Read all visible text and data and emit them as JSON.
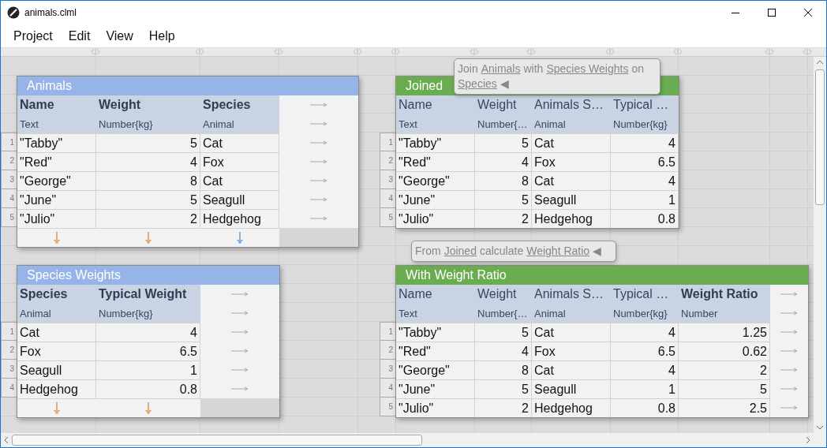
{
  "window": {
    "title": "animals.clml"
  },
  "menu": [
    "Project",
    "Edit",
    "View",
    "Help"
  ],
  "tables": [
    {
      "title": "Animals",
      "color": "#96b4e8",
      "add_row_arrows": true,
      "add_column_arrows": true,
      "columns": [
        {
          "name": "Name",
          "type": "Text",
          "bold": true,
          "kind": "text",
          "color": "#e0b080"
        },
        {
          "name": "Weight",
          "type": "Number{kg}",
          "bold": true,
          "kind": "number",
          "color": "#e0b080"
        },
        {
          "name": "Species",
          "type": "Animal",
          "bold": true,
          "kind": "text",
          "color": "#8ab4e0"
        }
      ],
      "rows": [
        {
          "number": "1",
          "cells": [
            "\"Tabby\"",
            "5",
            "Cat"
          ]
        },
        {
          "number": "2",
          "cells": [
            "\"Red\"",
            "4",
            "Fox"
          ]
        },
        {
          "number": "3",
          "cells": [
            "\"George\"",
            "8",
            "Cat"
          ]
        },
        {
          "number": "4",
          "cells": [
            "\"June\"",
            "5",
            "Seagull"
          ]
        },
        {
          "number": "5",
          "cells": [
            "\"Julio\"",
            "2",
            "Hedgehog"
          ]
        }
      ]
    },
    {
      "title": "Species Weights",
      "color": "#96b4e8",
      "add_row_arrows": true,
      "add_column_arrows": true,
      "columns": [
        {
          "name": "Species",
          "type": "Animal",
          "bold": true,
          "kind": "text",
          "color": "#e0b080"
        },
        {
          "name": "Typical Weight",
          "type": "Number{kg}",
          "bold": true,
          "kind": "number",
          "color": "#e0b080"
        }
      ],
      "rows": [
        {
          "number": "1",
          "cells": [
            "Cat",
            "4"
          ]
        },
        {
          "number": "2",
          "cells": [
            "Fox",
            "6.5"
          ]
        },
        {
          "number": "3",
          "cells": [
            "Seagull",
            "1"
          ]
        },
        {
          "number": "4",
          "cells": [
            "Hedgehog",
            "0.8"
          ]
        }
      ]
    },
    {
      "title": "Joined",
      "color": "#6aac50",
      "add_row_arrows": false,
      "add_column_arrows": false,
      "columns": [
        {
          "name": "Name",
          "type": "Text",
          "bold": false,
          "kind": "text"
        },
        {
          "name": "Weight",
          "type": "Number{…",
          "bold": false,
          "kind": "number"
        },
        {
          "name": "Animals S…",
          "type": "Animal",
          "bold": false,
          "kind": "text"
        },
        {
          "name": "Typical …",
          "type": "Number{kg}",
          "bold": false,
          "kind": "number"
        }
      ],
      "rows": [
        {
          "number": "1",
          "cells": [
            "\"Tabby\"",
            "5",
            "Cat",
            "4"
          ]
        },
        {
          "number": "2",
          "cells": [
            "\"Red\"",
            "4",
            "Fox",
            "6.5"
          ]
        },
        {
          "number": "3",
          "cells": [
            "\"George\"",
            "8",
            "Cat",
            "4"
          ]
        },
        {
          "number": "4",
          "cells": [
            "\"June\"",
            "5",
            "Seagull",
            "1"
          ]
        },
        {
          "number": "5",
          "cells": [
            "\"Julio\"",
            "2",
            "Hedgehog",
            "0.8"
          ]
        }
      ]
    },
    {
      "title": "With Weight Ratio",
      "color": "#6aac50",
      "add_row_arrows": true,
      "add_column_arrows": false,
      "columns": [
        {
          "name": "Name",
          "type": "Text",
          "bold": false,
          "kind": "text"
        },
        {
          "name": "Weight",
          "type": "Number{…",
          "bold": false,
          "kind": "number"
        },
        {
          "name": "Animals S…",
          "type": "Animal",
          "bold": false,
          "kind": "text"
        },
        {
          "name": "Typical …",
          "type": "Number{kg}",
          "bold": false,
          "kind": "number"
        },
        {
          "name": "Weight Ratio",
          "type": "Number",
          "bold": true,
          "kind": "number"
        }
      ],
      "rows": [
        {
          "number": "1",
          "cells": [
            "\"Tabby\"",
            "5",
            "Cat",
            "4",
            "1.25"
          ]
        },
        {
          "number": "2",
          "cells": [
            "\"Red\"",
            "4",
            "Fox",
            "6.5",
            "0.62"
          ]
        },
        {
          "number": "3",
          "cells": [
            "\"George\"",
            "8",
            "Cat",
            "4",
            "2"
          ]
        },
        {
          "number": "4",
          "cells": [
            "\"June\"",
            "5",
            "Seagull",
            "1",
            "5"
          ]
        },
        {
          "number": "5",
          "cells": [
            "\"Julio\"",
            "2",
            "Hedgehog",
            "0.8",
            "2.5"
          ]
        }
      ]
    }
  ],
  "formulas": [
    {
      "parts": [
        {
          "text": "Join",
          "kind": "plain"
        },
        {
          "text": "Animals",
          "kind": "link"
        },
        {
          "text": "with",
          "kind": "plain"
        },
        {
          "text": "Species Weights",
          "kind": "link"
        },
        {
          "text": "on",
          "kind": "plain"
        },
        {
          "text": "Species",
          "kind": "link"
        },
        {
          "text": "◀",
          "kind": "plain"
        }
      ]
    },
    {
      "parts": [
        {
          "text": "From",
          "kind": "plain"
        },
        {
          "text": "Joined",
          "kind": "link"
        },
        {
          "text": "calculate",
          "kind": "plain"
        },
        {
          "text": "Weight Ratio",
          "kind": "link"
        },
        {
          "text": "◀",
          "kind": "plain"
        }
      ]
    }
  ]
}
